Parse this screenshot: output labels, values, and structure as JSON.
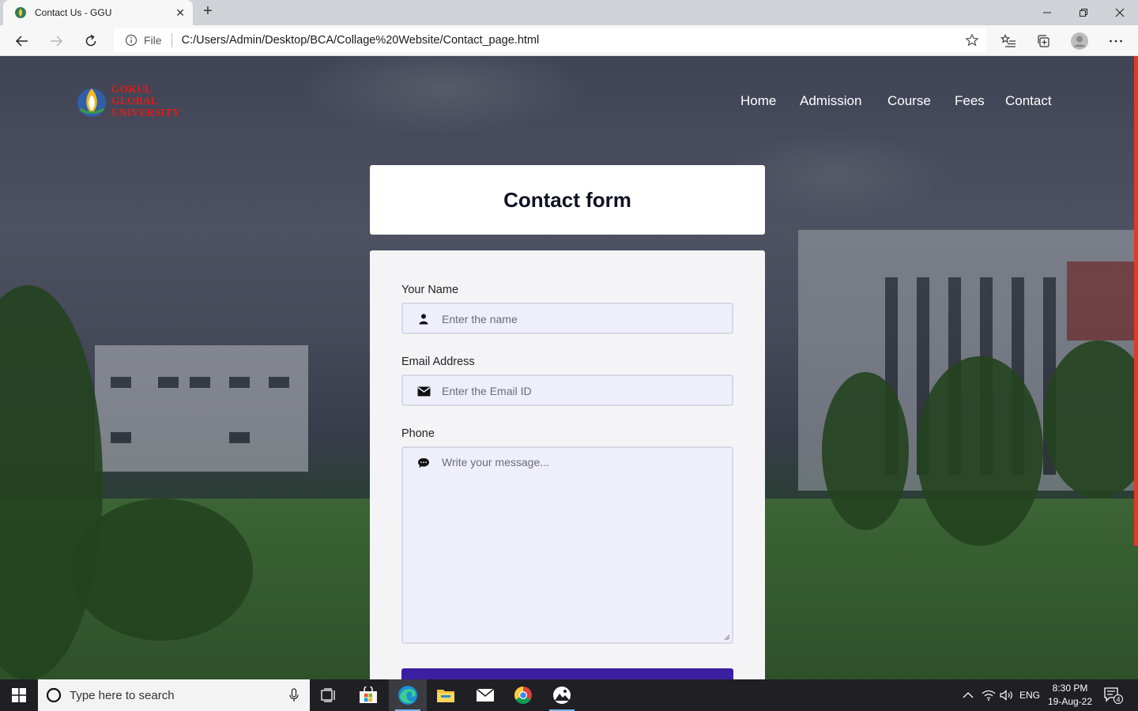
{
  "browser": {
    "tab_title": "Contact Us - GGU",
    "address_prefix": "File",
    "url": "C:/Users/Admin/Desktop/BCA/Collage%20Website/Contact_page.html"
  },
  "site": {
    "logo_lines": [
      "GOKUL",
      "GLOBAL",
      "UNIVERSITY"
    ],
    "nav": [
      "Home",
      "Admission",
      "Course",
      "Fees",
      "Contact"
    ]
  },
  "form": {
    "title": "Contact form",
    "name_label": "Your Name",
    "name_placeholder": "Enter the name",
    "email_label": "Email Address",
    "email_placeholder": "Enter the Email ID",
    "phone_label": "Phone",
    "message_placeholder": "Write your message..."
  },
  "taskbar": {
    "search_placeholder": "Type here to search",
    "language": "ENG",
    "time": "8:30 PM",
    "date": "19-Aug-22",
    "notification_count": "4"
  },
  "colors": {
    "logo_red": "#e01b17",
    "submit_button": "#3b1fa3",
    "field_background": "#efeefb"
  }
}
